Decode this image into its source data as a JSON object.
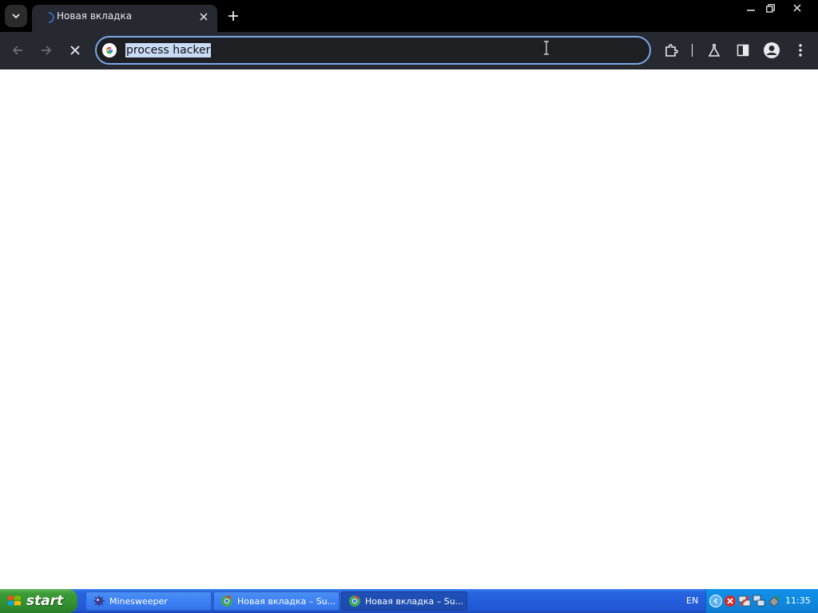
{
  "browser": {
    "tab": {
      "title": "Новая вкладка"
    },
    "omnibox": {
      "text": "process hacker"
    },
    "icons": {
      "tab_search": "chevron-down-icon",
      "tab_loading": "loading-spinner-icon",
      "tab_close": "close-icon",
      "new_tab": "plus-icon",
      "back": "arrow-left-icon",
      "forward": "arrow-right-icon",
      "stop": "close-icon",
      "omnibox": "google-g-icon",
      "extensions": "puzzle-icon",
      "labs": "flask-icon",
      "side_panel": "side-panel-icon",
      "profile": "account-icon",
      "menu": "kebab-menu-icon"
    },
    "colors": {
      "frame": "#000000",
      "toolbar": "#262a30",
      "omnibox_border": "#7ca6e6",
      "selection": "#c9dbf7"
    }
  },
  "taskbar": {
    "start_label": "start",
    "tasks": [
      {
        "label": "Minesweeper",
        "icon": "minesweeper-icon",
        "active": false
      },
      {
        "label": "Новая вкладка – Su...",
        "icon": "chrome-icon",
        "active": false
      },
      {
        "label": "Новая вкладка – Su...",
        "icon": "chrome-icon",
        "active": true
      }
    ],
    "language": "EN",
    "clock": "11:35",
    "colors": {
      "bar": "#245edc",
      "start": "#329131",
      "tray": "#0f8ae0"
    }
  }
}
